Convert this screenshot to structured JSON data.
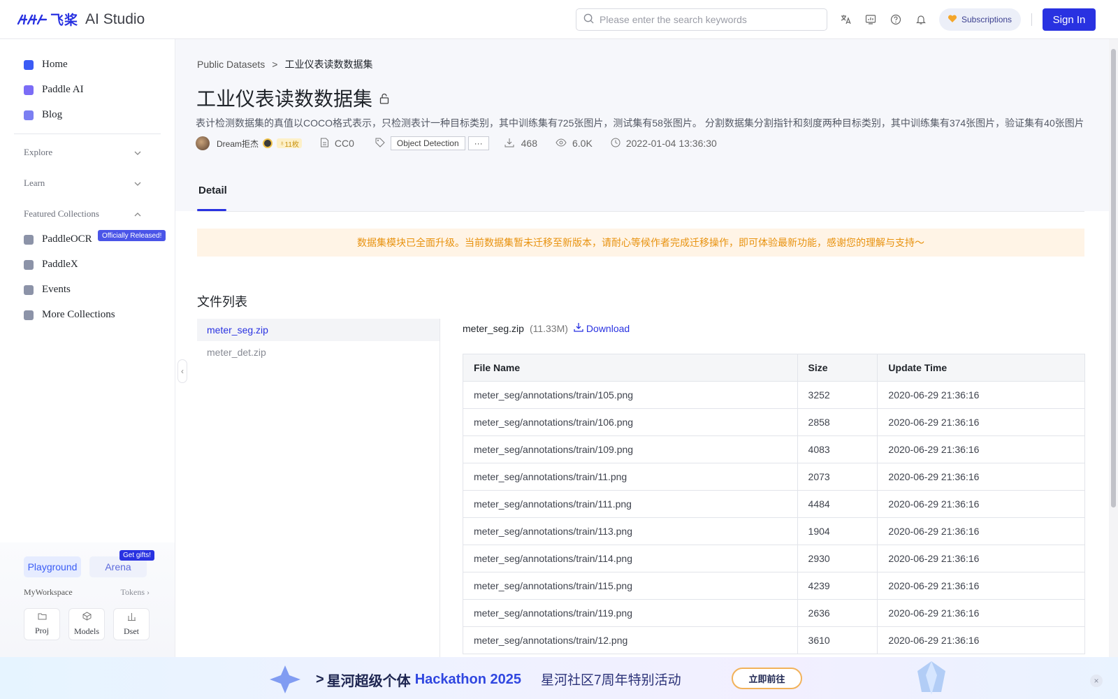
{
  "topbar": {
    "logo_cn": "飞桨",
    "logo_en": "AI Studio",
    "search_placeholder": "Please enter the search keywords",
    "subscriptions": "Subscriptions",
    "sign_in": "Sign In"
  },
  "sidebar": {
    "items": [
      {
        "label": "Home",
        "color": "#3b5bf5"
      },
      {
        "label": "Paddle AI",
        "color": "#7b6cf6"
      },
      {
        "label": "Blog",
        "color": "#7b7ff2"
      }
    ],
    "sections": {
      "explore": "Explore",
      "learn": "Learn",
      "featured": "Featured Collections"
    },
    "collections": [
      {
        "label": "PaddleOCR"
      },
      {
        "label": "PaddleX"
      },
      {
        "label": "Events"
      },
      {
        "label": "More Collections"
      }
    ],
    "released_badge": "Officially Released!",
    "playground": "Playground",
    "arena": "Arena",
    "gift_badge": "Get gifts!",
    "myworkspace": "MyWorkspace",
    "tokens": "Tokens",
    "ws_buttons": [
      "Proj",
      "Models",
      "Dset"
    ]
  },
  "breadcrumb": {
    "root": "Public Datasets",
    "sep": ">",
    "current": "工业仪表读数数据集"
  },
  "dataset": {
    "title": "工业仪表读数数据集",
    "description": "表计检测数据集的真值以COCO格式表示，只检测表计一种目标类别，其中训练集有725张图片，测试集有58张图片。 分割数据集分割指针和刻度两种目标类别，其中训练集有374张图片，验证集有40张图片",
    "author": "Dream拒杰",
    "coins": "11枚",
    "license": "CC0",
    "tag": "Object Detection",
    "more": "···",
    "downloads": "468",
    "views": "6.0K",
    "updated": "2022-01-04 13:36:30"
  },
  "tabs": {
    "detail": "Detail"
  },
  "notice": "数据集模块已全面升级。当前数据集暂未迁移至新版本，请耐心等候作者完成迁移操作，即可体验最新功能，感谢您的理解与支持～",
  "files": {
    "heading": "文件列表",
    "list": [
      {
        "name": "meter_seg.zip",
        "active": true
      },
      {
        "name": "meter_det.zip",
        "active": false
      }
    ],
    "selected_name": "meter_seg.zip",
    "selected_size": "(11.33M)",
    "download": "Download",
    "columns": [
      "File Name",
      "Size",
      "Update Time"
    ],
    "rows": [
      [
        "meter_seg/annotations/train/105.png",
        "3252",
        "2020-06-29 21:36:16"
      ],
      [
        "meter_seg/annotations/train/106.png",
        "2858",
        "2020-06-29 21:36:16"
      ],
      [
        "meter_seg/annotations/train/109.png",
        "4083",
        "2020-06-29 21:36:16"
      ],
      [
        "meter_seg/annotations/train/11.png",
        "2073",
        "2020-06-29 21:36:16"
      ],
      [
        "meter_seg/annotations/train/111.png",
        "4484",
        "2020-06-29 21:36:16"
      ],
      [
        "meter_seg/annotations/train/113.png",
        "1904",
        "2020-06-29 21:36:16"
      ],
      [
        "meter_seg/annotations/train/114.png",
        "2930",
        "2020-06-29 21:36:16"
      ],
      [
        "meter_seg/annotations/train/115.png",
        "4239",
        "2020-06-29 21:36:16"
      ],
      [
        "meter_seg/annotations/train/119.png",
        "2636",
        "2020-06-29 21:36:16"
      ],
      [
        "meter_seg/annotations/train/12.png",
        "3610",
        "2020-06-29 21:36:16"
      ]
    ]
  },
  "banner": {
    "prefix": ">",
    "title_cn": "星河超级个体",
    "title_en": "Hackathon 2025",
    "subtitle": "星河社区7周年特别活动",
    "button": "立即前往",
    "close": "×"
  }
}
